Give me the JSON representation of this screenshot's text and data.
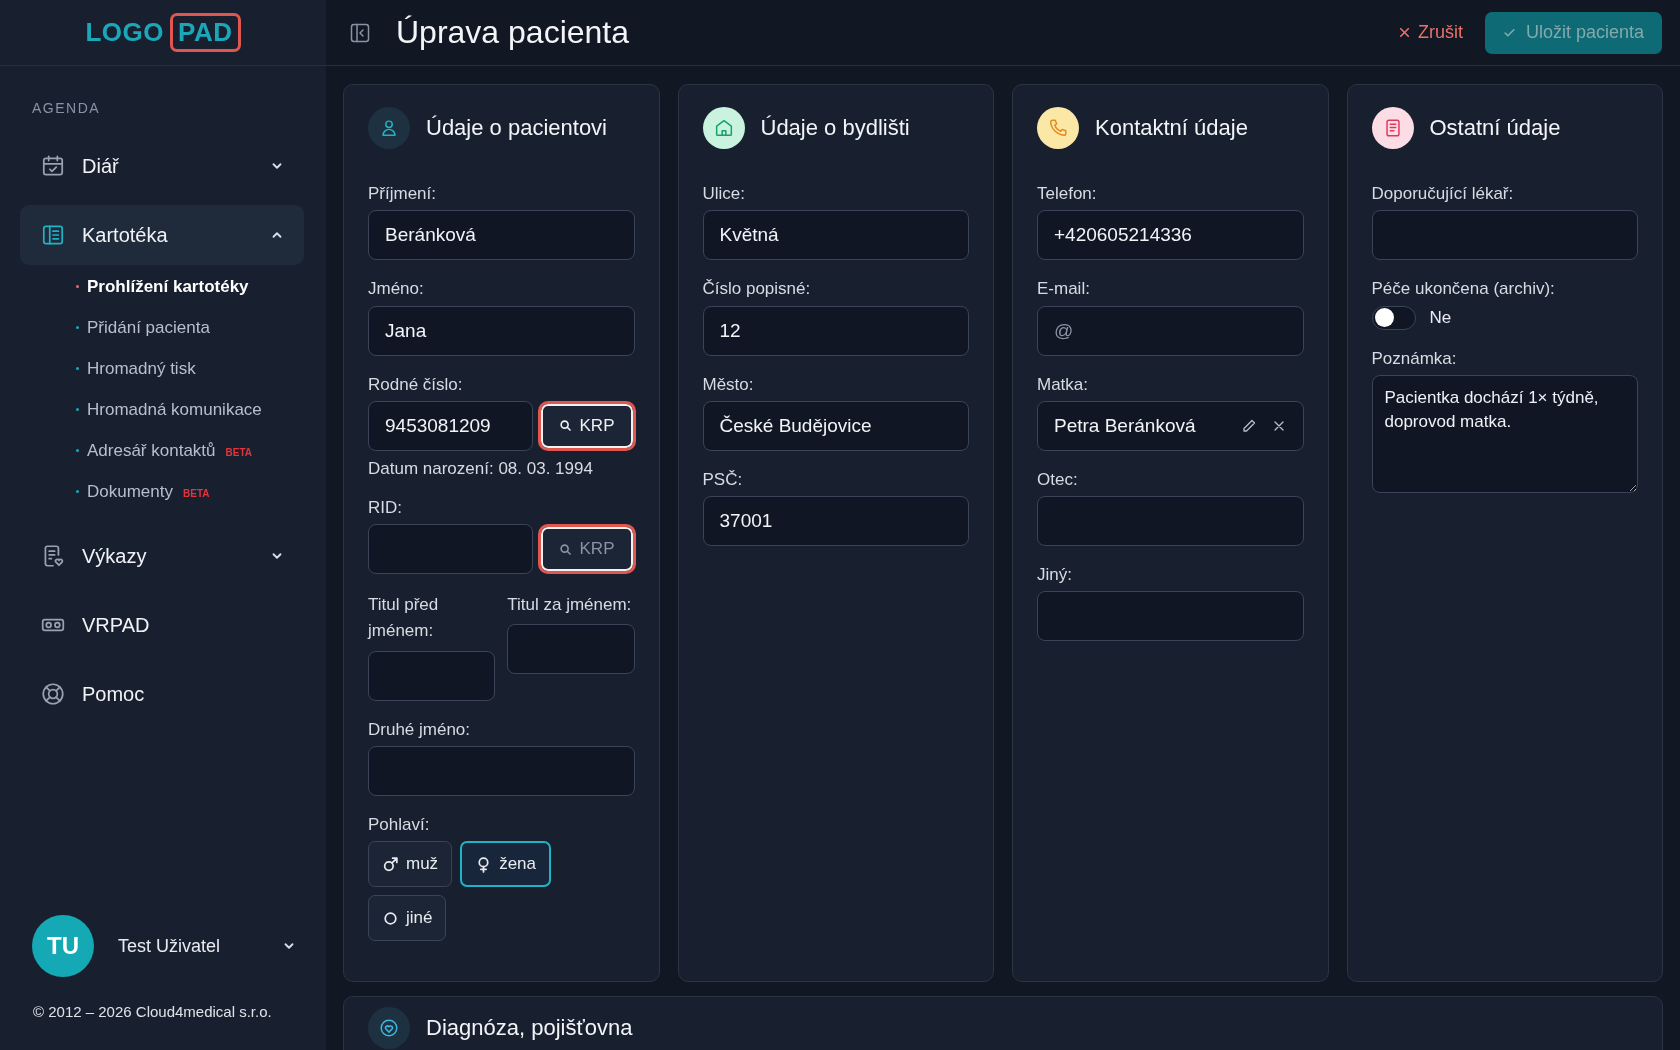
{
  "logo": {
    "text": "LOGO",
    "boxed_text": "PAD"
  },
  "sidebar": {
    "section": "AGENDA",
    "nav": [
      {
        "kind": "group",
        "label": "Diář",
        "selected": false,
        "expanded": false
      },
      {
        "kind": "group",
        "label": "Kartotéka",
        "selected": true,
        "expanded": true,
        "children": [
          {
            "label": "Prohlížení kartotéky",
            "selected": true
          },
          {
            "label": "Přidání pacienta",
            "selected": false
          },
          {
            "label": "Hromadný tisk",
            "selected": false
          },
          {
            "label": "Hromadná komunikace",
            "selected": false
          },
          {
            "label": "Adresář kontaktů",
            "selected": false,
            "badge": "BETA"
          },
          {
            "label": "Dokumenty",
            "selected": false,
            "badge": "BETA"
          }
        ]
      },
      {
        "kind": "group",
        "label": "Výkazy",
        "selected": false,
        "expanded": false
      },
      {
        "kind": "link",
        "label": "VRPAD",
        "selected": false
      },
      {
        "kind": "link",
        "label": "Pomoc",
        "selected": false
      }
    ],
    "user": {
      "initials": "TU",
      "name": "Test Uživatel"
    },
    "copyright": "© 2012 – 2026 Cloud4medical s.r.o."
  },
  "header": {
    "title": "Úprava pacienta",
    "cancel": "Zrušit",
    "save": {
      "label": "Uložit pacienta",
      "disabled": true
    }
  },
  "cards": [
    {
      "title": "Údaje o pacientovi",
      "fields": [
        {
          "kind": "input",
          "label": "Příjmení:",
          "value": "Beránková"
        },
        {
          "kind": "input",
          "label": "Jméno:",
          "value": "Jana"
        },
        {
          "kind": "lookup",
          "label": "Rodné číslo:",
          "value": "9453081209",
          "button": {
            "label": "KRP",
            "disabled": false,
            "highlighted": true
          },
          "note": "Datum narození: 08. 03. 1994"
        },
        {
          "kind": "lookup",
          "label": "RID:",
          "button": {
            "label": "KRP",
            "disabled": true,
            "highlighted": true
          }
        },
        {
          "kind": "pair",
          "items": [
            {
              "label": "Titul před jménem:"
            },
            {
              "label": "Titul za jménem:"
            }
          ]
        },
        {
          "kind": "input",
          "label": "Druhé jméno:"
        },
        {
          "kind": "choice",
          "label": "Pohlaví:",
          "options": [
            {
              "label": "muž",
              "selected": false
            },
            {
              "label": "žena",
              "selected": true
            },
            {
              "label": "jiné",
              "selected": false
            }
          ]
        }
      ]
    },
    {
      "title": "Údaje o bydlišti",
      "fields": [
        {
          "kind": "input",
          "label": "Ulice:",
          "value": "Květná"
        },
        {
          "kind": "input",
          "label": "Číslo popisné:",
          "value": "12"
        },
        {
          "kind": "input",
          "label": "Město:",
          "value": "České Budějovice"
        },
        {
          "kind": "input",
          "label": "PSČ:",
          "value": "37001"
        }
      ]
    },
    {
      "title": "Kontaktní údaje",
      "fields": [
        {
          "kind": "input",
          "label": "Telefon:",
          "value": "+420605214336"
        },
        {
          "kind": "input",
          "label": "E-mail:",
          "placeholder": "@"
        },
        {
          "kind": "person",
          "label": "Matka:",
          "value": "Petra Beránková"
        },
        {
          "kind": "input",
          "label": "Otec:"
        },
        {
          "kind": "input",
          "label": "Jiný:"
        }
      ]
    },
    {
      "title": "Ostatní údaje",
      "fields": [
        {
          "kind": "input",
          "label": "Doporučující lékař:"
        },
        {
          "kind": "toggle",
          "label": "Péče ukončena (archiv):",
          "on": false,
          "state_text": "Ne"
        },
        {
          "kind": "textarea",
          "label": "Poznámka:",
          "value": "Pacientka dochází 1× týdně, doprovod matka."
        }
      ]
    }
  ],
  "bottom_card": {
    "title": "Diagnóza, pojišťovna"
  }
}
